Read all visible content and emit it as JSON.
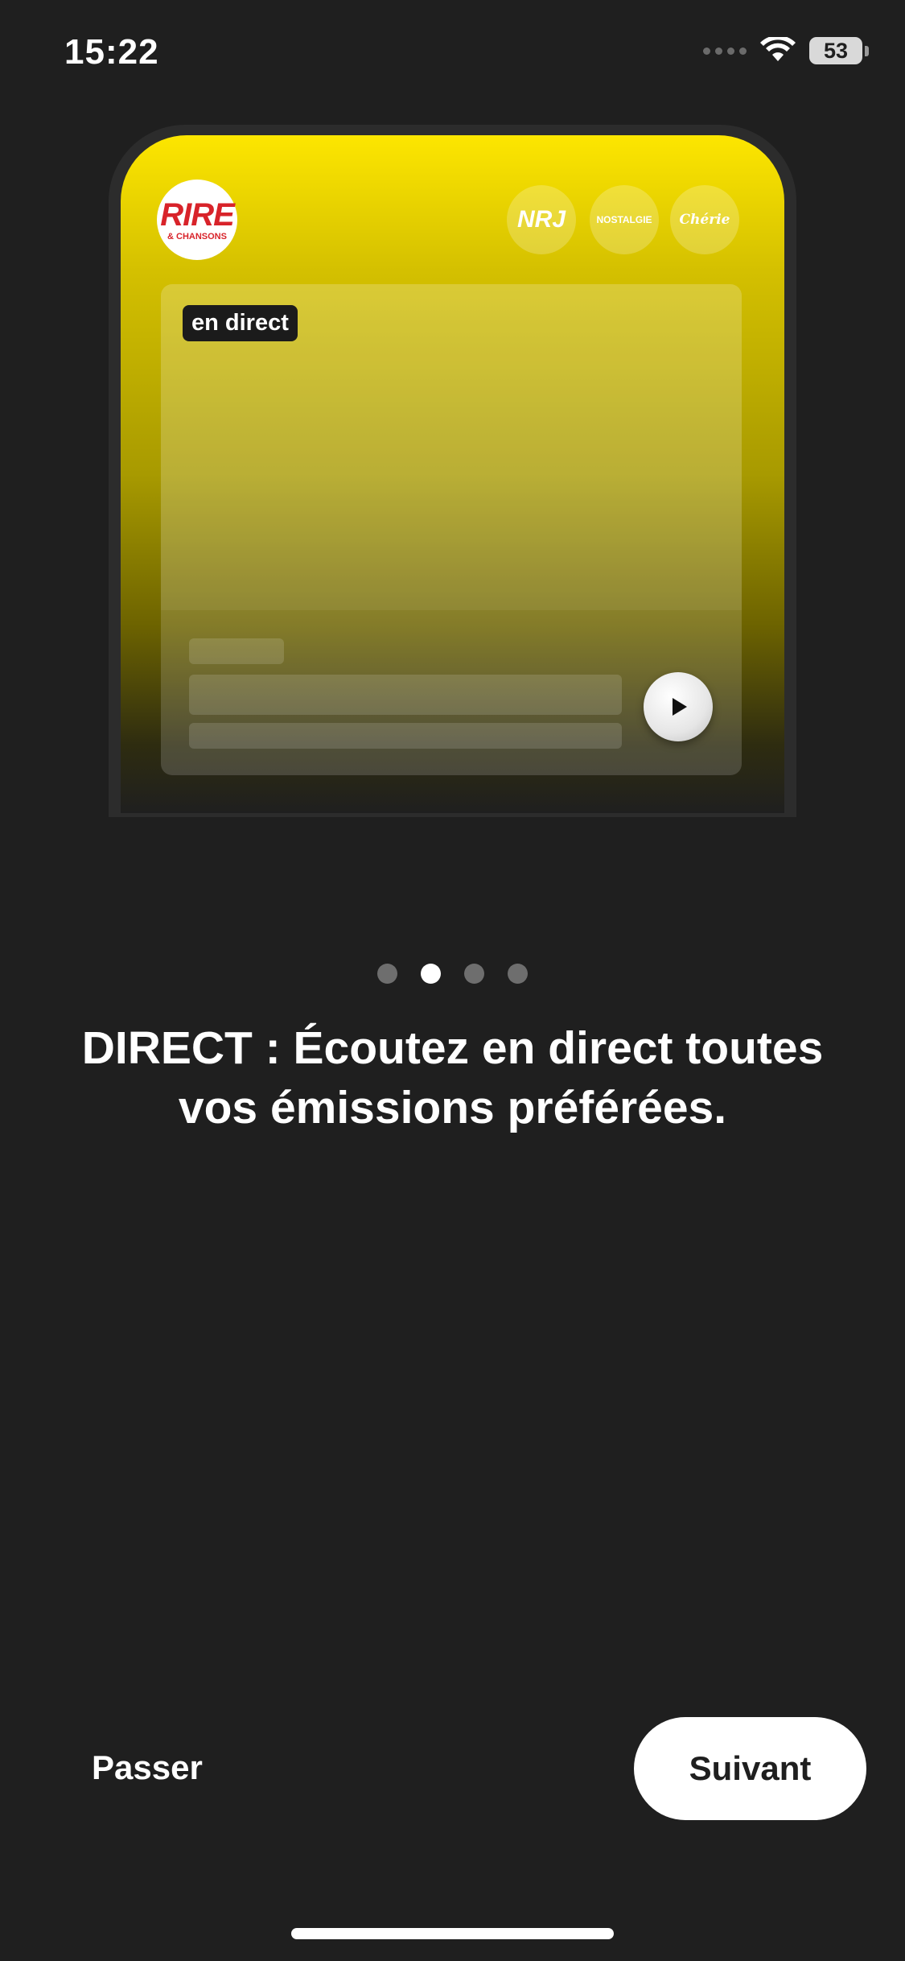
{
  "status_bar": {
    "time": "15:22",
    "battery": "53"
  },
  "mockup": {
    "main_station": {
      "logo_top": "RIRE",
      "logo_bottom": "& CHANSONS"
    },
    "stations": [
      {
        "name": "NRJ"
      },
      {
        "name": "NOSTALGIE"
      },
      {
        "name": "Chérie"
      }
    ],
    "live_badge": "en direct"
  },
  "pagination": {
    "total": 4,
    "active_index": 1
  },
  "headline": "DIRECT : Écoutez en direct toutes vos émissions préférées.",
  "buttons": {
    "skip": "Passer",
    "next": "Suivant"
  },
  "colors": {
    "background": "#1f1f1f",
    "accent_yellow": "#fde600",
    "brand_red": "#d8232a"
  }
}
